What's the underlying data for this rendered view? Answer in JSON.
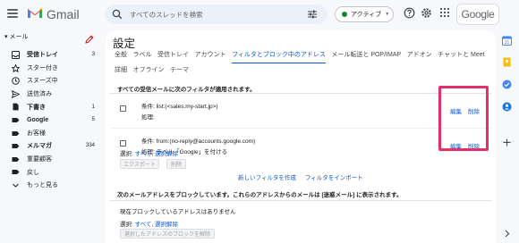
{
  "header": {
    "app_name": "Gmail",
    "search_placeholder": "すべてのスレッドを検索",
    "status_label": "アクティブ",
    "account_label": "Google"
  },
  "sidebar": {
    "section_label": "メール",
    "items": [
      {
        "label": "受信トレイ",
        "count": "3",
        "bold": true,
        "icon": "inbox-icon"
      },
      {
        "label": "スター付き",
        "count": "",
        "bold": false,
        "icon": "star-icon"
      },
      {
        "label": "スヌーズ中",
        "count": "",
        "bold": false,
        "icon": "clock-icon"
      },
      {
        "label": "送信済み",
        "count": "",
        "bold": false,
        "icon": "send-icon"
      },
      {
        "label": "下書き",
        "count": "1",
        "bold": true,
        "icon": "draft-icon"
      },
      {
        "label": "Google",
        "count": "5",
        "bold": true,
        "icon": "label-icon"
      },
      {
        "label": "お客様",
        "count": "",
        "bold": false,
        "icon": "label-icon"
      },
      {
        "label": "メルマガ",
        "count": "334",
        "bold": true,
        "icon": "label-icon"
      },
      {
        "label": "重要顧客",
        "count": "",
        "bold": false,
        "icon": "label-icon"
      },
      {
        "label": "戻し",
        "count": "",
        "bold": false,
        "icon": "label-icon"
      },
      {
        "label": "もっと見る",
        "count": "",
        "bold": false,
        "icon": "chevron-down-icon"
      }
    ]
  },
  "settings": {
    "title": "設定",
    "tabs_row1": [
      "全般",
      "ラベル",
      "受信トレイ",
      "アカウント",
      "フィルタとブロック中のアドレス",
      "メール転送と POP/IMAP",
      "アドオン",
      "チャットと Meet"
    ],
    "tabs_row2": [
      "詳細",
      "オフライン",
      "テーマ"
    ],
    "active_tab": "フィルタとブロック中のアドレス",
    "filters_heading": "すべての受信メールに次のフィルタが適用されます。",
    "filters": [
      {
        "condition": "条件: list:(<sales.my-start.jp>)",
        "action": "処理:",
        "edit": "編集",
        "delete": "削除"
      },
      {
        "condition": "条件: from:(no-reply@accounts.google.com)",
        "action": "処理: ラベル「Google」を付ける",
        "edit": "編集",
        "delete": "削除"
      }
    ],
    "select_label": "選択:",
    "select_all": "すべて",
    "select_none": "選択解除",
    "export_button": "エクスポート",
    "delete_button": "削除",
    "create_filter_link": "新しいフィルタを作成",
    "import_filter_link": "フィルタをインポート",
    "block_heading": "次のメールアドレスをブロックしています。これらのアドレスからのメールは [迷惑メール] に表示されます。",
    "no_block_text": "現在ブロックしているアドレスはありません",
    "unblock_button": "選択したアドレスのブロックを解除"
  },
  "colors": {
    "accent": "#0b57d0",
    "highlight": "#e2306c",
    "active_green": "#188038"
  }
}
